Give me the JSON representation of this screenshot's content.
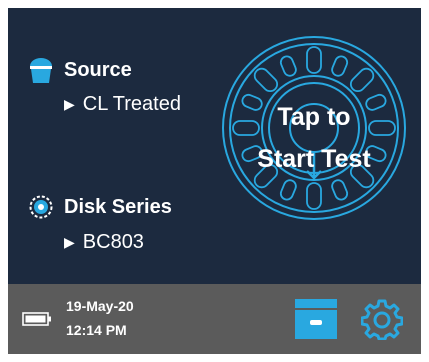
{
  "source": {
    "heading": "Source",
    "value": "CL Treated"
  },
  "disk_series": {
    "heading": "Disk Series",
    "value": "BC803"
  },
  "start_button": {
    "line1": "Tap to",
    "line2": "Start Test"
  },
  "footer": {
    "date": "19-May-20",
    "time": "12:14 PM"
  },
  "icons": {
    "source": "bucket-icon",
    "disk_series": "disk-icon",
    "battery": "battery-icon",
    "archive": "archive-box-icon",
    "settings": "gear-icon"
  },
  "colors": {
    "background": "#1c2a3f",
    "accent": "#29a8e0",
    "footer": "#5b5b5b"
  }
}
